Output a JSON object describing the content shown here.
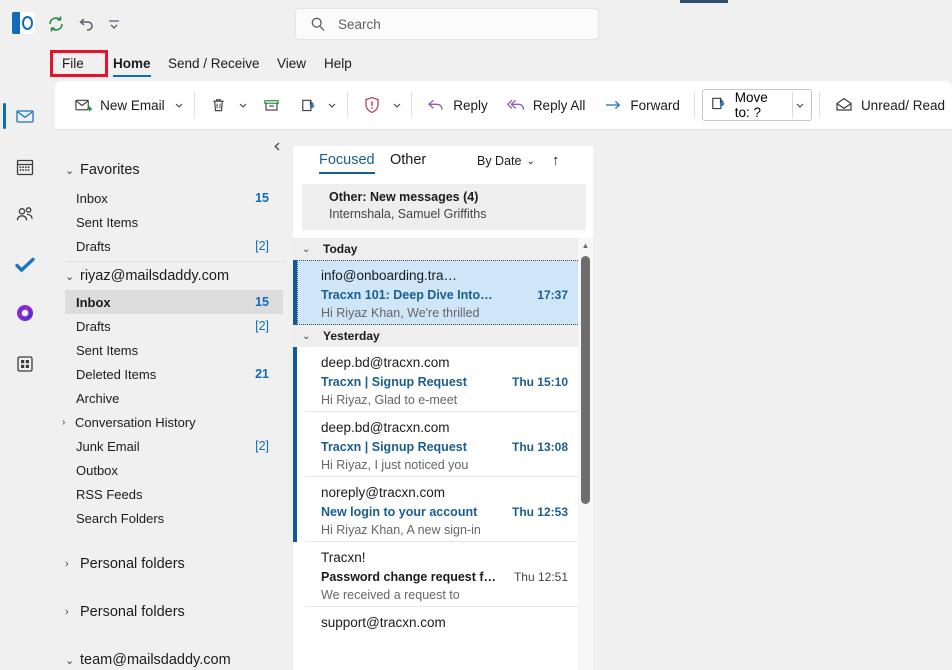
{
  "app": {
    "logo_icon": "outlook-logo-icon",
    "quick_access": [
      {
        "name": "refresh-icon",
        "label": "Refresh"
      },
      {
        "name": "undo-icon",
        "label": "Undo"
      },
      {
        "name": "customize-quick-access-icon",
        "label": "Customize Quick Access Toolbar"
      }
    ]
  },
  "search": {
    "placeholder": "Search",
    "icon": "search-icon"
  },
  "menu": {
    "tabs": [
      {
        "id": "file",
        "label": "File",
        "active": false,
        "highlighted": true
      },
      {
        "id": "home",
        "label": "Home",
        "active": true,
        "highlighted": false
      },
      {
        "id": "send_receive",
        "label": "Send / Receive",
        "active": false,
        "highlighted": false
      },
      {
        "id": "view",
        "label": "View",
        "active": false,
        "highlighted": false
      },
      {
        "id": "help",
        "label": "Help",
        "active": false,
        "highlighted": false
      }
    ],
    "highlight_color": "#e8112d"
  },
  "ribbon": {
    "new_email": {
      "label": "New Email",
      "icon": "new-email-icon"
    },
    "delete": {
      "label": "Delete",
      "icon": "trash-icon"
    },
    "archive": {
      "label": "Archive",
      "icon": "archive-icon"
    },
    "move_inbox": {
      "label": "Move to Inbox",
      "icon": "move-to-inbox-icon"
    },
    "report": {
      "label": "Report",
      "icon": "report-shield-icon"
    },
    "reply": {
      "label": "Reply",
      "icon": "reply-icon"
    },
    "reply_all": {
      "label": "Reply All",
      "icon": "reply-all-icon"
    },
    "forward": {
      "label": "Forward",
      "icon": "forward-arrow-icon"
    },
    "move_to": {
      "label": "Move to: ?",
      "icon": "move-to-icon"
    },
    "unread_read": {
      "label": "Unread/ Read",
      "icon": "envelope-open-icon"
    }
  },
  "rail": {
    "items": [
      {
        "name": "mail-app-icon",
        "label": "Mail",
        "active": true
      },
      {
        "name": "calendar-app-icon",
        "label": "Calendar",
        "active": false
      },
      {
        "name": "people-app-icon",
        "label": "People",
        "active": false
      },
      {
        "name": "todo-app-icon",
        "label": "To Do",
        "active": false
      },
      {
        "name": "onenote-app-icon",
        "label": "OneNote",
        "active": false
      },
      {
        "name": "more-apps-icon",
        "label": "More apps",
        "active": false
      }
    ]
  },
  "folder_pane": {
    "collapse_icon": "chevron-left-icon",
    "groups": [
      {
        "id": "favorites",
        "title": "Favorites",
        "expanded": true,
        "chevron": "chevron-down-icon",
        "items": [
          {
            "label": "Inbox",
            "count": "15",
            "bracket": false,
            "chevron": null,
            "selected": false
          },
          {
            "label": "Sent Items",
            "count": "",
            "bracket": false,
            "chevron": null,
            "selected": false
          },
          {
            "label": "Drafts",
            "count": "[2]",
            "bracket": true,
            "chevron": null,
            "selected": false
          }
        ]
      },
      {
        "id": "riyaz_account",
        "title": "riyaz@mailsdaddy.com",
        "expanded": true,
        "chevron": "chevron-down-icon",
        "items": [
          {
            "label": "Inbox",
            "count": "15",
            "bracket": false,
            "chevron": null,
            "selected": true
          },
          {
            "label": "Drafts",
            "count": "[2]",
            "bracket": true,
            "chevron": null,
            "selected": false
          },
          {
            "label": "Sent Items",
            "count": "",
            "bracket": false,
            "chevron": null,
            "selected": false
          },
          {
            "label": "Deleted Items",
            "count": "21",
            "bracket": false,
            "chevron": null,
            "selected": false
          },
          {
            "label": "Archive",
            "count": "",
            "bracket": false,
            "chevron": null,
            "selected": false
          },
          {
            "label": "Conversation History",
            "count": "",
            "bracket": false,
            "chevron": "chevron-right-icon",
            "selected": false
          },
          {
            "label": "Junk Email",
            "count": "[2]",
            "bracket": true,
            "chevron": null,
            "selected": false
          },
          {
            "label": "Outbox",
            "count": "",
            "bracket": false,
            "chevron": null,
            "selected": false
          },
          {
            "label": "RSS Feeds",
            "count": "",
            "bracket": false,
            "chevron": null,
            "selected": false
          },
          {
            "label": "Search Folders",
            "count": "",
            "bracket": false,
            "chevron": null,
            "selected": false
          }
        ]
      },
      {
        "id": "personal_folders_1",
        "title": "Personal folders",
        "expanded": false,
        "chevron": "chevron-right-icon",
        "items": []
      },
      {
        "id": "personal_folders_2",
        "title": "Personal folders",
        "expanded": false,
        "chevron": "chevron-right-icon",
        "items": []
      },
      {
        "id": "team_account",
        "title": "team@mailsdaddy.com",
        "expanded": true,
        "chevron": "chevron-down-icon",
        "items": []
      }
    ]
  },
  "message_list": {
    "tabs": [
      {
        "id": "focused",
        "label": "Focused",
        "active": true
      },
      {
        "id": "other",
        "label": "Other",
        "active": false
      }
    ],
    "sort": {
      "label": "By Date",
      "chevron": "chevron-down-icon"
    },
    "sort_direction_icon": "arrow-up-icon",
    "other_banner": {
      "title": "Other: New messages (4)",
      "subtitle": "Internshala, Samuel Griffiths"
    },
    "groups": [
      {
        "label": "Today",
        "chevron": "chevron-down-icon",
        "messages": [
          {
            "sender": "info@onboarding.tra…",
            "subject": "Tracxn 101: Deep Dive Into…",
            "time": "17:37",
            "preview": "Hi Riyaz Khan,  We're thrilled",
            "unread": true,
            "selected": true
          }
        ]
      },
      {
        "label": "Yesterday",
        "chevron": "chevron-down-icon",
        "messages": [
          {
            "sender": "deep.bd@tracxn.com",
            "subject": "Tracxn | Signup Request",
            "time": "Thu 15:10",
            "preview": "Hi Riyaz,  Glad to e-meet",
            "unread": true,
            "selected": false
          },
          {
            "sender": "deep.bd@tracxn.com",
            "subject": "Tracxn | Signup Request",
            "time": "Thu 13:08",
            "preview": "Hi Riyaz,  I just noticed you",
            "unread": true,
            "selected": false
          },
          {
            "sender": "noreply@tracxn.com",
            "subject": "New login to your account",
            "time": "Thu 12:53",
            "preview": "Hi Riyaz Khan,  A new sign-in",
            "unread": true,
            "selected": false
          },
          {
            "sender": "Tracxn!",
            "subject": "Password change request f…",
            "time": "Thu 12:51",
            "preview": "We received a request to",
            "unread": false,
            "selected": false
          },
          {
            "sender": "support@tracxn.com",
            "subject": "",
            "time": "",
            "preview": "",
            "unread": false,
            "selected": false
          }
        ]
      }
    ],
    "scrollbar": {
      "up_arrow_icon": "scroll-up-arrow-icon"
    }
  },
  "colors": {
    "accent": "#0f6cbd",
    "selected_row": "#cfe5f8",
    "unread_bar": "#0f5a9c",
    "link": "#1a5e8f",
    "highlight_box": "#e8112d"
  }
}
